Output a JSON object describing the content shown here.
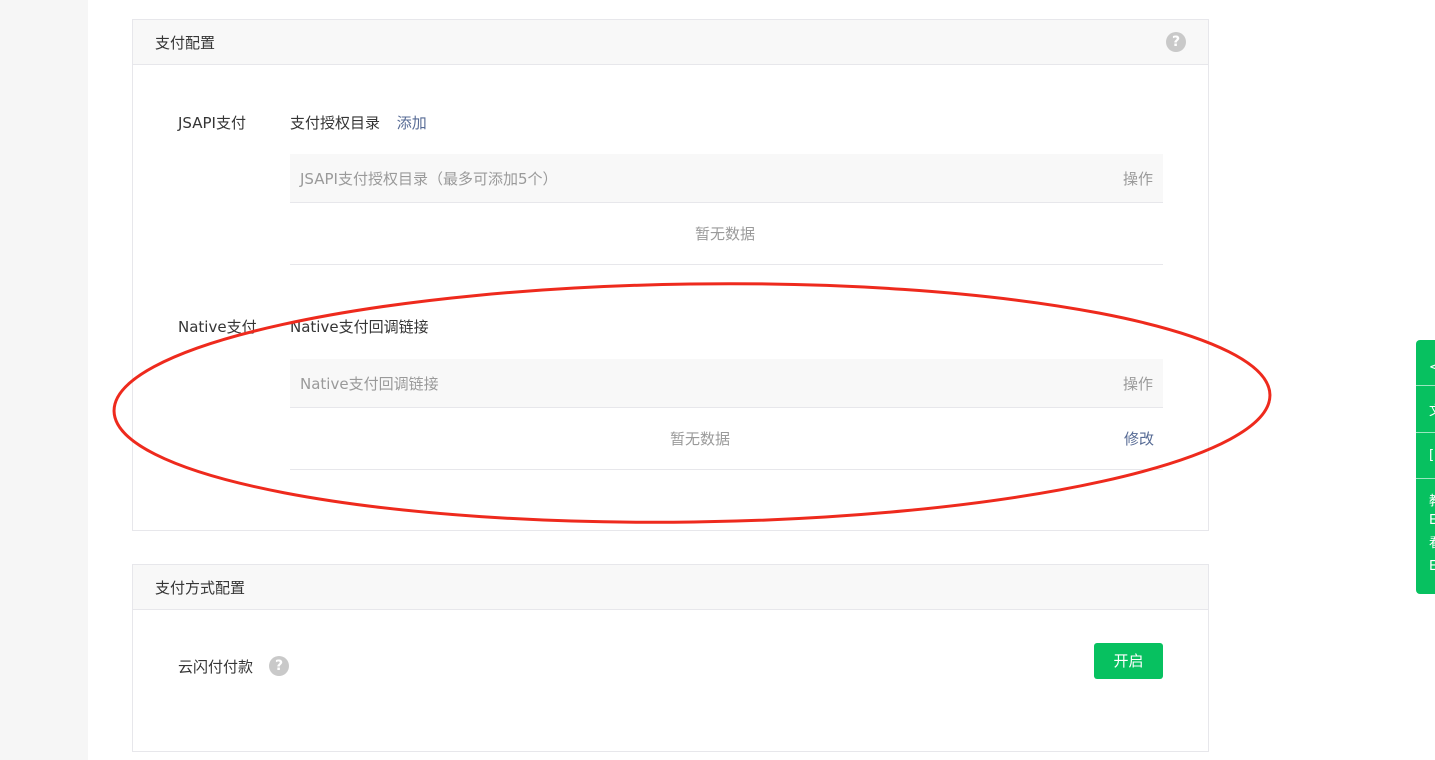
{
  "pay_config": {
    "title": "支付配置",
    "help_icon": "?",
    "jsapi": {
      "label": "JSAPI支付",
      "sub_label": "支付授权目录",
      "add_link": "添加",
      "table": {
        "col1": "JSAPI支付授权目录（最多可添加5个）",
        "col2": "操作",
        "empty": "暂无数据"
      }
    },
    "native": {
      "label": "Native支付",
      "sub_label": "Native支付回调链接",
      "table": {
        "col1": "Native支付回调链接",
        "col2": "操作",
        "empty": "暂无数据",
        "edit": "修改"
      }
    }
  },
  "pay_method_config": {
    "title": "支付方式配置",
    "item_label": "云闪付付款",
    "help_icon": "?",
    "enable_button": "开启"
  },
  "side_float": {
    "glyphs": [
      "<",
      "文",
      "[",
      "教",
      "E",
      "看",
      "E"
    ]
  },
  "colors": {
    "accent_green": "#07c160",
    "link_blue": "#576b95",
    "annotation_red": "#ee2a1d"
  }
}
